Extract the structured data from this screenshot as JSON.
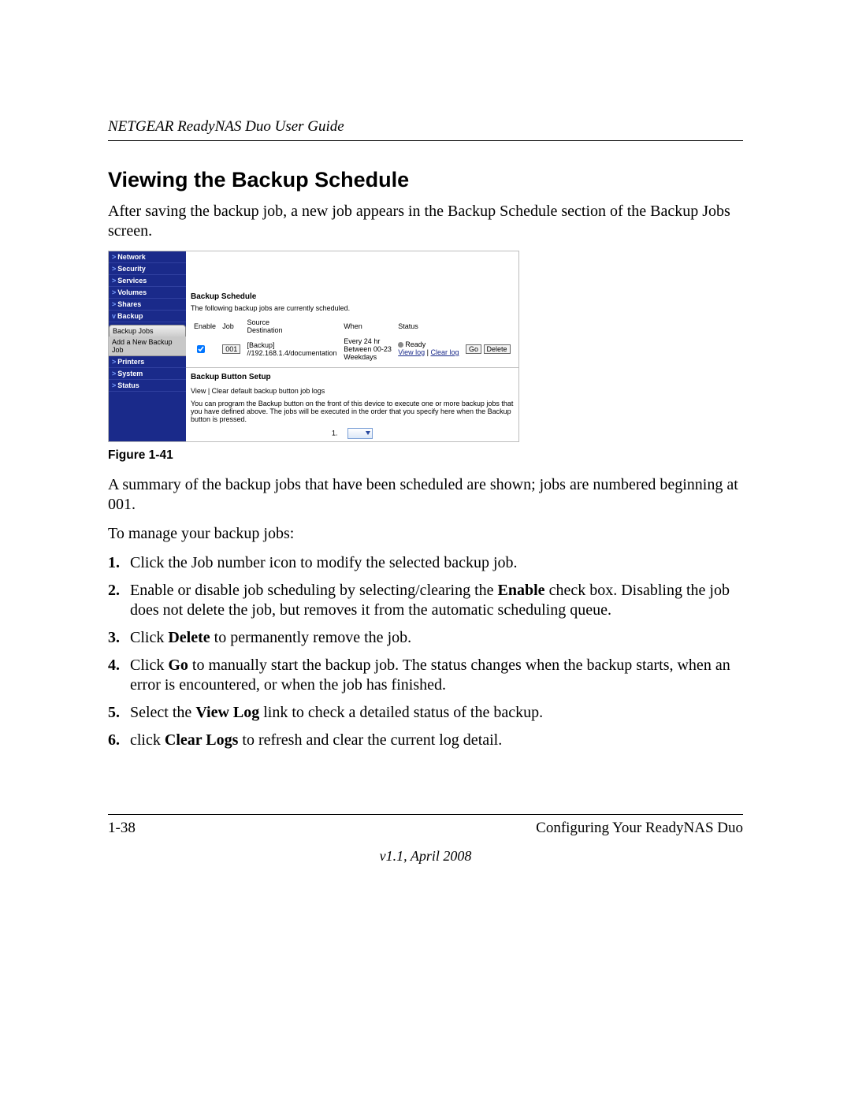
{
  "header": {
    "running_head": "NETGEAR ReadyNAS Duo User Guide"
  },
  "section": {
    "title": "Viewing the Backup Schedule",
    "intro": "After saving the backup job, a new job appears in the Backup Schedule section of the Backup Jobs screen."
  },
  "figure": {
    "caption": "Figure 1-41",
    "nav": {
      "items": [
        "Network",
        "Security",
        "Services",
        "Volumes",
        "Shares",
        "Backup",
        "Printers",
        "System",
        "Status"
      ],
      "sub_items": [
        "Backup Jobs",
        "Add a New Backup Job"
      ]
    },
    "schedule": {
      "title": "Backup Schedule",
      "subtitle": "The following backup jobs are currently scheduled.",
      "headers": {
        "enable": "Enable",
        "job": "Job",
        "srcdst": "Source\nDestination",
        "when": "When",
        "status": "Status"
      },
      "row": {
        "enable_checked": true,
        "job": "001",
        "source": "[Backup]",
        "dest": "//192.168.1.4/documentation",
        "when_l1": "Every 24 hr",
        "when_l2": "Between 00-23",
        "when_l3": "Weekdays",
        "status_ready": "Ready",
        "view_log": "View log",
        "clear_log": "Clear log",
        "go": "Go",
        "delete": "Delete"
      }
    },
    "button_setup": {
      "title": "Backup Button Setup",
      "links": "View | Clear default backup button job logs",
      "desc": "You can program the Backup button on the front of this device to execute one or more backup jobs that you have defined above. The jobs will be executed in the order that you specify here when the Backup button is pressed.",
      "row_num": "1."
    }
  },
  "summary": {
    "p1": "A summary of the backup jobs that have been scheduled are shown; jobs are numbered beginning at 001.",
    "p2": "To manage your backup jobs:"
  },
  "steps": {
    "s1": "Click the Job number icon to modify the selected backup job.",
    "s2a": "Enable or disable job scheduling by selecting/clearing the ",
    "s2b": "Enable",
    "s2c": " check box. Disabling the job does not delete the job, but removes it from the automatic scheduling queue.",
    "s3a": "Click ",
    "s3b": "Delete",
    "s3c": " to permanently remove the job.",
    "s4a": "Click ",
    "s4b": "Go",
    "s4c": " to manually start the backup job. The status changes when the backup starts, when an error is encountered, or when the job has finished.",
    "s5a": "Select the ",
    "s5b": "View Log",
    "s5c": " link to check a detailed status of the backup.",
    "s6a": "click ",
    "s6b": "Clear Logs",
    "s6c": " to refresh and clear the current log detail."
  },
  "footer": {
    "page": "1-38",
    "chapter": "Configuring Your ReadyNAS Duo",
    "version": "v1.1, April 2008"
  }
}
